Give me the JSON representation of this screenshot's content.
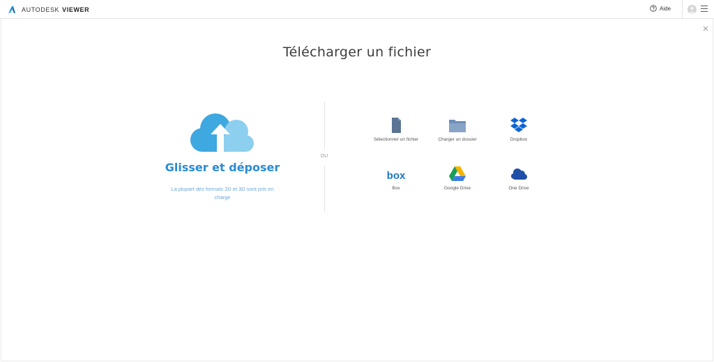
{
  "header": {
    "brand_name": "AUTODESK",
    "brand_product": "VIEWER",
    "help_label": "Aide",
    "icons": {
      "logo": "autodesk-logo",
      "help": "question-circle-icon",
      "avatar": "user-avatar",
      "menu": "hamburger-icon"
    }
  },
  "dialog": {
    "title": "Télécharger un fichier",
    "close_icon": "close-icon",
    "drop_zone": {
      "title": "Glisser et déposer",
      "subtitle": "La plupart des formats 2D et 3D sont pris en charge",
      "icon": "cloud-upload-icon"
    },
    "separator_label": "OU",
    "sources": [
      {
        "label": "Sélectionner un fichier",
        "icon": "file-icon"
      },
      {
        "label": "Charger un dossier",
        "icon": "folder-icon"
      },
      {
        "label": "Dropbox",
        "icon": "dropbox-icon"
      },
      {
        "label": "Box",
        "icon": "box-icon"
      },
      {
        "label": "Google Drive",
        "icon": "google-drive-icon"
      },
      {
        "label": "One Drive",
        "icon": "onedrive-icon"
      }
    ]
  },
  "colors": {
    "accent": "#2a8bd6",
    "subtitle": "#6aa7dc",
    "cloud_back": "#3ea8e0",
    "cloud_front": "#8dcfee",
    "file_icon": "#5b7494",
    "folder_icon": "#6d8fb8",
    "dropbox": "#0d64d7",
    "box": "#1a79c9",
    "onedrive": "#1f4fa6"
  }
}
